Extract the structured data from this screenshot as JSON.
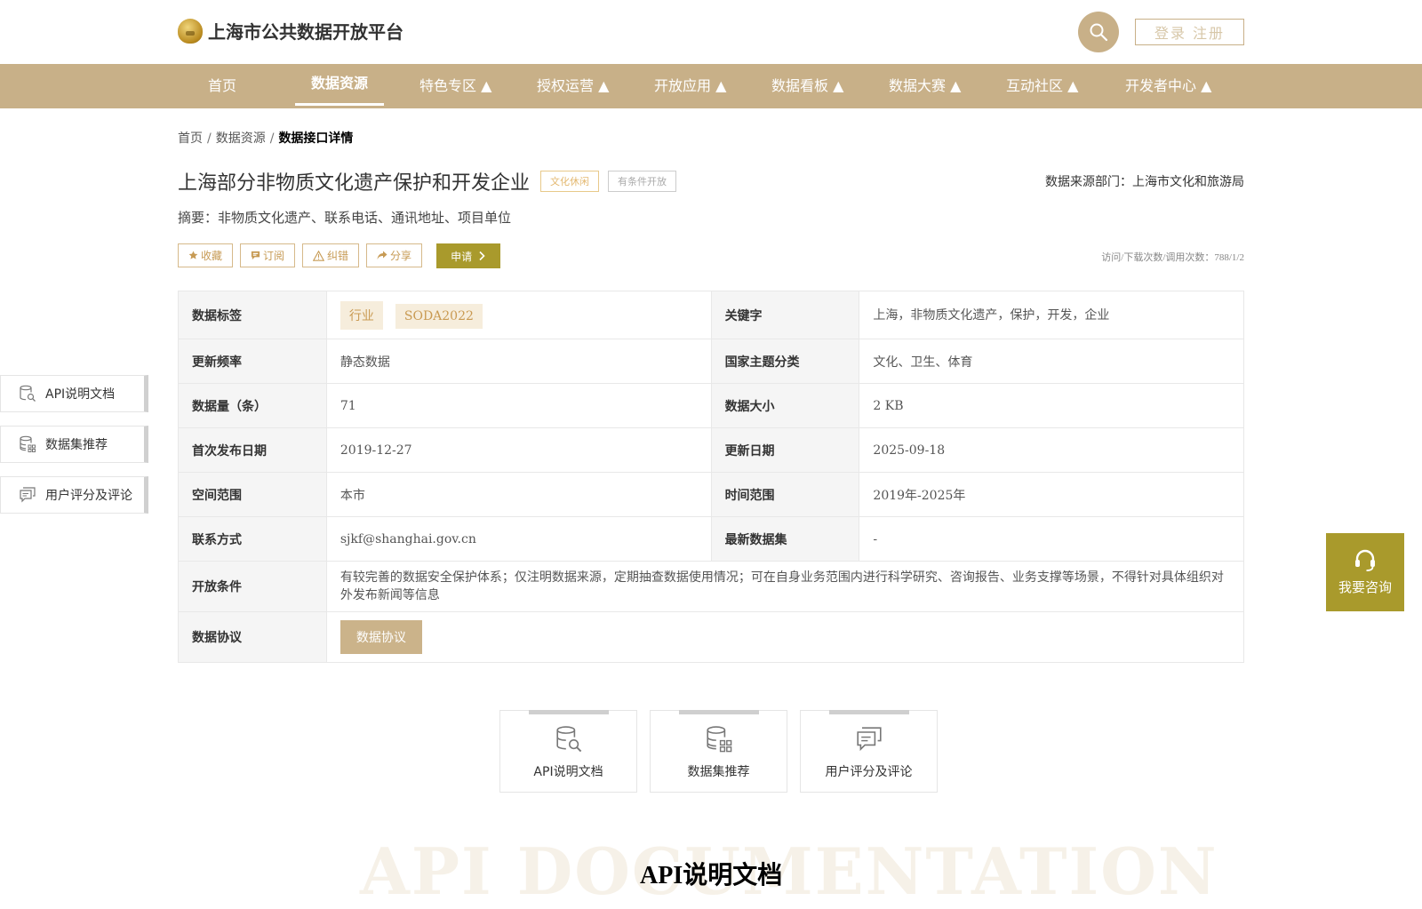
{
  "header": {
    "site_title": "上海市公共数据开放平台",
    "login_label": "登录 注册"
  },
  "nav": {
    "items": [
      "首页",
      "数据资源",
      "特色专区 ▲",
      "授权运营 ▲",
      "开放应用 ▲",
      "数据看板 ▲",
      "数据大赛 ▲",
      "互动社区 ▲",
      "开发者中心 ▲"
    ],
    "active": "数据资源"
  },
  "breadcrumb": {
    "home": "首页",
    "sep": "/",
    "resources": "数据资源",
    "current": "数据接口详情"
  },
  "detail": {
    "title": "上海部分非物质文化遗产保护和开发企业",
    "tag_category": "文化休闲",
    "tag_open": "有条件开放",
    "source": "数据来源部门：上海市文化和旅游局",
    "summary": "摘要：非物质文化遗产、联系电话、通讯地址、项目单位",
    "visits": "访问/下载次数/调用次数：788/1/2"
  },
  "actions": {
    "favorite": "收藏",
    "subscribe": "订阅",
    "report": "纠错",
    "share": "分享",
    "apply": "申请"
  },
  "table": {
    "label_tags": "数据标签",
    "tags": [
      "行业",
      "SODA2022"
    ],
    "label_keywords": "关键字",
    "keywords": "上海，非物质文化遗产，保护，开发，企业",
    "label_frequency": "更新频率",
    "frequency": "静态数据",
    "label_theme": "国家主题分类",
    "theme": "文化、卫生、体育",
    "label_count": "数据量（条）",
    "count": "71",
    "label_size": "数据大小",
    "size": "2 KB",
    "label_first_release": "首次发布日期",
    "first_release": "2019-12-27",
    "label_update": "更新日期",
    "update": "2025-09-18",
    "label_space": "空间范围",
    "space": "本市",
    "label_time": "时间范围",
    "time": "2019年-2025年",
    "label_contact": "联系方式",
    "contact": "sjkf@shanghai.gov.cn",
    "label_latest": "最新数据集",
    "latest": "-",
    "label_conditions": "开放条件",
    "conditions": "有较完善的数据安全保护体系；仅注明数据来源，定期抽查数据使用情况；可在自身业务范围内进行科学研究、咨询报告、业务支撑等场景，不得针对具体组织对外发布新闻等信息",
    "label_protocol": "数据协议",
    "protocol_button": "数据协议"
  },
  "sidebar": {
    "items": [
      "API说明文档",
      "数据集推荐",
      "用户评分及评论"
    ]
  },
  "cards": {
    "items": [
      "API说明文档",
      "数据集推荐",
      "用户评分及评论"
    ]
  },
  "consult": {
    "label": "我要咨询"
  },
  "section": {
    "bg_text": "API DOCUMENTATION",
    "title": "API说明文档"
  },
  "colors": {
    "accent": "#c8b088",
    "olive": "#a99a2c",
    "tag_gold": "#c99a52"
  },
  "icons": [
    "search-icon",
    "star-icon",
    "subscribe-icon",
    "warning-icon",
    "share-icon",
    "chevron-right-icon",
    "doc-search-icon",
    "database-icon",
    "comment-icon",
    "headset-icon"
  ]
}
